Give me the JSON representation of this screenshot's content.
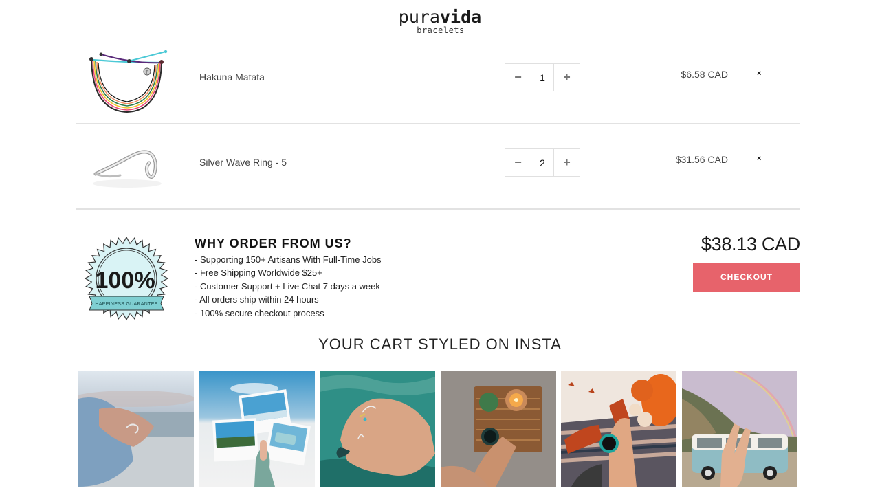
{
  "header": {
    "logo_main_light": "pura",
    "logo_main_bold": "vida",
    "logo_sub": "bracelets"
  },
  "cart": {
    "items": [
      {
        "name": "Hakuna Matata",
        "quantity": "1",
        "price": "$6.58 CAD",
        "image": "multicolor-string-bracelet"
      },
      {
        "name": "Silver Wave Ring - 5",
        "quantity": "2",
        "price": "$31.56 CAD",
        "image": "silver-wave-ring"
      }
    ],
    "decrement_label": "−",
    "increment_label": "+",
    "remove_label": "×"
  },
  "guarantee": {
    "percent": "100%",
    "ribbon": "HAPPINESS GUARANTEE",
    "colors": {
      "fill": "#d9f3f5",
      "ribbon": "#7fcfd2"
    }
  },
  "why": {
    "title": "WHY ORDER FROM US?",
    "points": [
      "- Supporting 150+ Artisans With Full-Time Jobs",
      "- Free Shipping Worldwide $25+",
      "- Customer Support + Live Chat 7 days a week",
      "- All orders ship within 24 hours",
      "- 100% secure checkout process"
    ]
  },
  "summary": {
    "total": "$38.13 CAD",
    "checkout_label": "CHECKOUT",
    "accent_color": "#e7636b"
  },
  "insta": {
    "title": "YOUR CART STYLED ON INSTA",
    "tiles": [
      {
        "subject": "hand-wave-ring-beach"
      },
      {
        "subject": "polaroids-beach"
      },
      {
        "subject": "rings-hand-water"
      },
      {
        "subject": "basket-candle-mug"
      },
      {
        "subject": "autumn-pumpkins-mug"
      },
      {
        "subject": "van-rainbow-peace"
      }
    ]
  }
}
